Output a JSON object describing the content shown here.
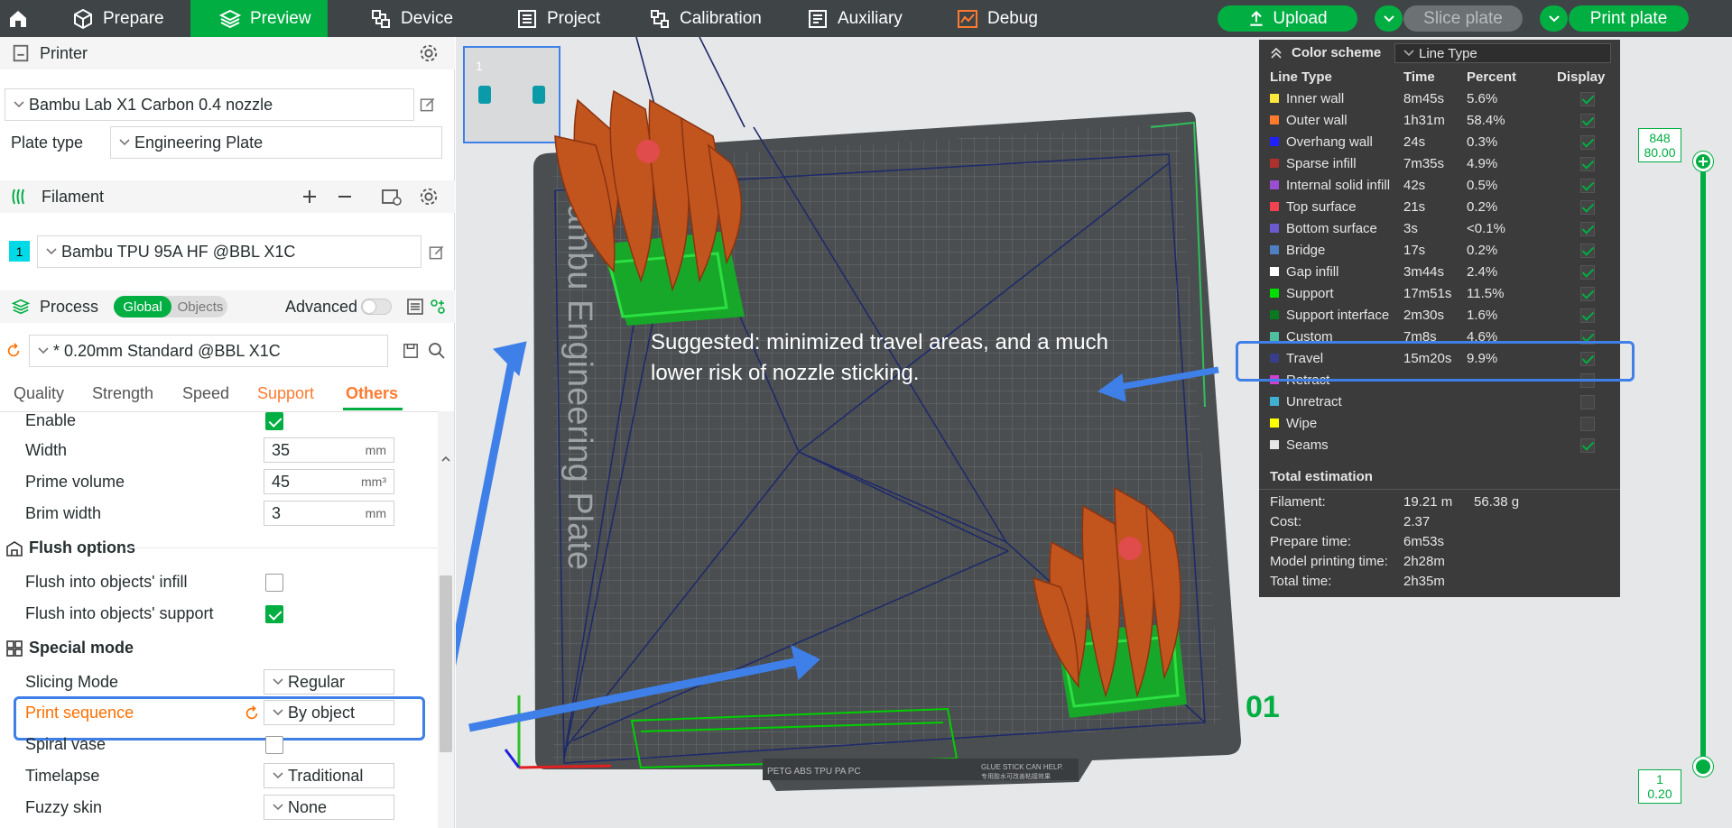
{
  "topbar": {
    "tabs": [
      {
        "label": "Prepare",
        "icon": "cube-icon"
      },
      {
        "label": "Preview",
        "icon": "layers-icon",
        "active": true
      },
      {
        "label": "Device",
        "icon": "device-icon"
      },
      {
        "label": "Project",
        "icon": "project-icon"
      },
      {
        "label": "Calibration",
        "icon": "calibration-icon"
      },
      {
        "label": "Auxiliary",
        "icon": "auxiliary-icon"
      },
      {
        "label": "Debug",
        "icon": "debug-icon"
      }
    ],
    "upload_label": "Upload",
    "slice_label": "Slice plate",
    "print_label": "Print plate",
    "accent_color": "#00ae42"
  },
  "printer": {
    "section_title": "Printer",
    "name": "Bambu Lab X1 Carbon 0.4 nozzle",
    "plate_type_label": "Plate type",
    "plate_type": "Engineering Plate"
  },
  "filament": {
    "section_title": "Filament",
    "slot": "1",
    "name": "Bambu TPU 95A HF @BBL X1C",
    "color": "#00d9e6"
  },
  "process": {
    "section_title": "Process",
    "toggle_global": "Global",
    "toggle_objects": "Objects",
    "advanced_label": "Advanced",
    "preset": "* 0.20mm Standard @BBL X1C",
    "tabs": [
      "Quality",
      "Strength",
      "Speed",
      "Support",
      "Others"
    ],
    "active_tab": "Others"
  },
  "options": {
    "enable_label": "Enable",
    "width_label": "Width",
    "width_value": "35",
    "width_unit": "mm",
    "prime_volume_label": "Prime volume",
    "prime_volume_value": "45",
    "prime_volume_unit": "mm³",
    "brim_width_label": "Brim width",
    "brim_width_value": "3",
    "brim_width_unit": "mm",
    "flush_group": "Flush options",
    "flush_infill_label": "Flush into objects' infill",
    "flush_support_label": "Flush into objects' support",
    "special_group": "Special mode",
    "slicing_mode_label": "Slicing Mode",
    "slicing_mode_value": "Regular",
    "print_sequence_label": "Print sequence",
    "print_sequence_value": "By object",
    "spiral_vase_label": "Spiral vase",
    "timelapse_label": "Timelapse",
    "timelapse_value": "Traditional",
    "fuzzy_skin_label": "Fuzzy skin",
    "fuzzy_skin_value": "None"
  },
  "viewport": {
    "plate_thumb_number": "1",
    "annotation_line1": "Suggested: minimized travel areas, and a much",
    "annotation_line2": "lower risk of nozzle sticking.",
    "plate_label": "01",
    "plate_text": "Bambu Engineering Plate",
    "plate_footer_left": "PETG ABS TPU PA PC",
    "plate_footer_right": "GLUE STICK CAN HELP.",
    "plate_footer_cn": "专用胶水可改善粘接效果",
    "highlight_color": "#3f7fe8"
  },
  "legend": {
    "color_scheme_label": "Color scheme",
    "color_scheme_value": "Line Type",
    "col_line_type": "Line Type",
    "col_time": "Time",
    "col_percent": "Percent",
    "col_display": "Display",
    "rows": [
      {
        "name": "Inner wall",
        "time": "8m45s",
        "percent": "5.6%",
        "color": "#ffe63c",
        "on": true
      },
      {
        "name": "Outer wall",
        "time": "1h31m",
        "percent": "58.4%",
        "color": "#ff7a2f",
        "on": true
      },
      {
        "name": "Overhang wall",
        "time": "24s",
        "percent": "0.3%",
        "color": "#2020ff",
        "on": true
      },
      {
        "name": "Sparse infill",
        "time": "7m35s",
        "percent": "4.9%",
        "color": "#b0302d",
        "on": true
      },
      {
        "name": "Internal solid infill",
        "time": "42s",
        "percent": "0.5%",
        "color": "#9a4fd0",
        "on": true
      },
      {
        "name": "Top surface",
        "time": "21s",
        "percent": "0.2%",
        "color": "#f0424f",
        "on": true
      },
      {
        "name": "Bottom surface",
        "time": "3s",
        "percent": "<0.1%",
        "color": "#6a5acd",
        "on": true
      },
      {
        "name": "Bridge",
        "time": "17s",
        "percent": "0.2%",
        "color": "#4e7fc0",
        "on": true
      },
      {
        "name": "Gap infill",
        "time": "3m44s",
        "percent": "2.4%",
        "color": "#ffffff",
        "on": true
      },
      {
        "name": "Support",
        "time": "17m51s",
        "percent": "11.5%",
        "color": "#00e000",
        "on": true
      },
      {
        "name": "Support interface",
        "time": "2m30s",
        "percent": "1.6%",
        "color": "#0a7a20",
        "on": true
      },
      {
        "name": "Custom",
        "time": "7m8s",
        "percent": "4.6%",
        "color": "#4fbf9f",
        "on": true
      },
      {
        "name": "Travel",
        "time": "15m20s",
        "percent": "9.9%",
        "color": "#383f88",
        "on": true
      },
      {
        "name": "Retract",
        "time": "",
        "percent": "",
        "color": "#cf40cf",
        "on": false
      },
      {
        "name": "Unretract",
        "time": "",
        "percent": "",
        "color": "#3fb0d0",
        "on": false
      },
      {
        "name": "Wipe",
        "time": "",
        "percent": "",
        "color": "#ffff00",
        "on": false
      },
      {
        "name": "Seams",
        "time": "",
        "percent": "",
        "color": "#e6e6e6",
        "on": true
      }
    ],
    "total_title": "Total estimation",
    "filament_label": "Filament:",
    "filament_length": "19.21 m",
    "filament_weight": "56.38 g",
    "cost_label": "Cost:",
    "cost_value": "2.37",
    "prepare_label": "Prepare time:",
    "prepare_value": "6m53s",
    "model_label": "Model printing time:",
    "model_value": "2h28m",
    "total_label": "Total time:",
    "total_value": "2h35m"
  },
  "layer_slider": {
    "top_layer": "848",
    "top_height": "80.00",
    "bottom_layer": "1",
    "bottom_height": "0.20"
  }
}
